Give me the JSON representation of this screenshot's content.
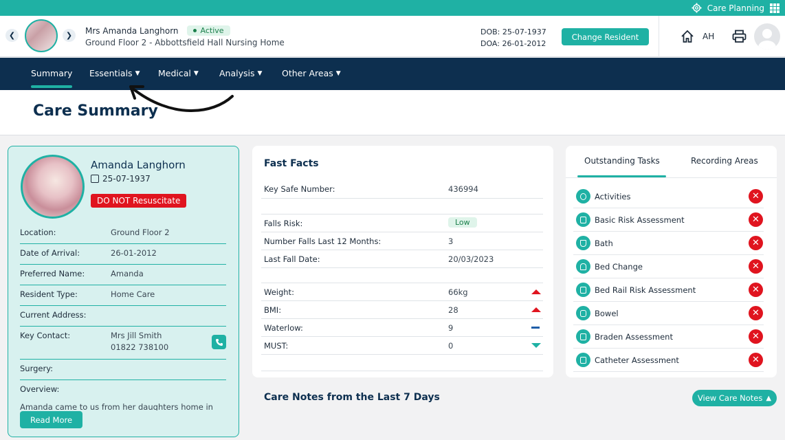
{
  "topbar": {
    "app_label": "Care Planning"
  },
  "header": {
    "resident_name": "Mrs Amanda Langhorn",
    "status": "Active",
    "location": "Ground Floor 2 - Abbottsfield Hall Nursing Home",
    "dob": "DOB: 25-07-1937",
    "doa": "DOA: 26-01-2012",
    "change_button": "Change Resident",
    "user_initials": "AH"
  },
  "nav": {
    "items": [
      {
        "label": "Summary",
        "has_dropdown": false
      },
      {
        "label": "Essentials",
        "has_dropdown": true
      },
      {
        "label": "Medical",
        "has_dropdown": true
      },
      {
        "label": "Analysis",
        "has_dropdown": true
      },
      {
        "label": "Other Areas",
        "has_dropdown": true
      }
    ],
    "active": "Summary"
  },
  "page_title": "Care Summary",
  "profile": {
    "name": "Amanda Langhorn",
    "dob": "25-07-1937",
    "alert": "DO NOT Resuscitate",
    "rows": [
      {
        "label": "Location:",
        "value": "Ground Floor 2"
      },
      {
        "label": "Date of Arrival:",
        "value": "26-01-2012"
      },
      {
        "label": "Preferred Name:",
        "value": "Amanda"
      },
      {
        "label": "Resident Type:",
        "value": "Home Care"
      },
      {
        "label": "Current Address:",
        "value": ""
      },
      {
        "label": "Key Contact:",
        "value": "Mrs Jill Smith",
        "value2": "01822 738100"
      },
      {
        "label": "Surgery:",
        "value": ""
      },
      {
        "label": "Overview:",
        "value": ""
      }
    ],
    "overview_text": "Amanda came to us from her daughters home in",
    "read_more": "Read More"
  },
  "fast_facts": {
    "title": "Fast Facts",
    "key_safe": {
      "label": "Key Safe Number:",
      "value": "436994"
    },
    "falls_risk": {
      "label": "Falls Risk:",
      "value": "Low"
    },
    "falls_count": {
      "label": "Number Falls Last 12 Months:",
      "value": "3"
    },
    "last_fall": {
      "label": "Last Fall Date:",
      "value": "20/03/2023"
    },
    "weight": {
      "label": "Weight:",
      "value": "66kg",
      "trend": "up"
    },
    "bmi": {
      "label": "BMI:",
      "value": "28",
      "trend": "up"
    },
    "waterlow": {
      "label": "Waterlow:",
      "value": "9",
      "trend": "flat"
    },
    "must": {
      "label": "MUST:",
      "value": "0",
      "trend": "down"
    }
  },
  "tasks": {
    "tab_active": "Outstanding Tasks",
    "tab_other": "Recording Areas",
    "items": [
      "Activities",
      "Basic Risk Assessment",
      "Bath",
      "Bed Change",
      "Bed Rail Risk Assessment",
      "Bowel",
      "Braden Assessment",
      "Catheter Assessment"
    ]
  },
  "care_notes": {
    "title": "Care Notes from the Last 7 Days",
    "view_button": "View Care Notes"
  },
  "colors": {
    "teal": "#1fb1a4",
    "navy": "#0d2f4f",
    "red": "#e0141f"
  }
}
